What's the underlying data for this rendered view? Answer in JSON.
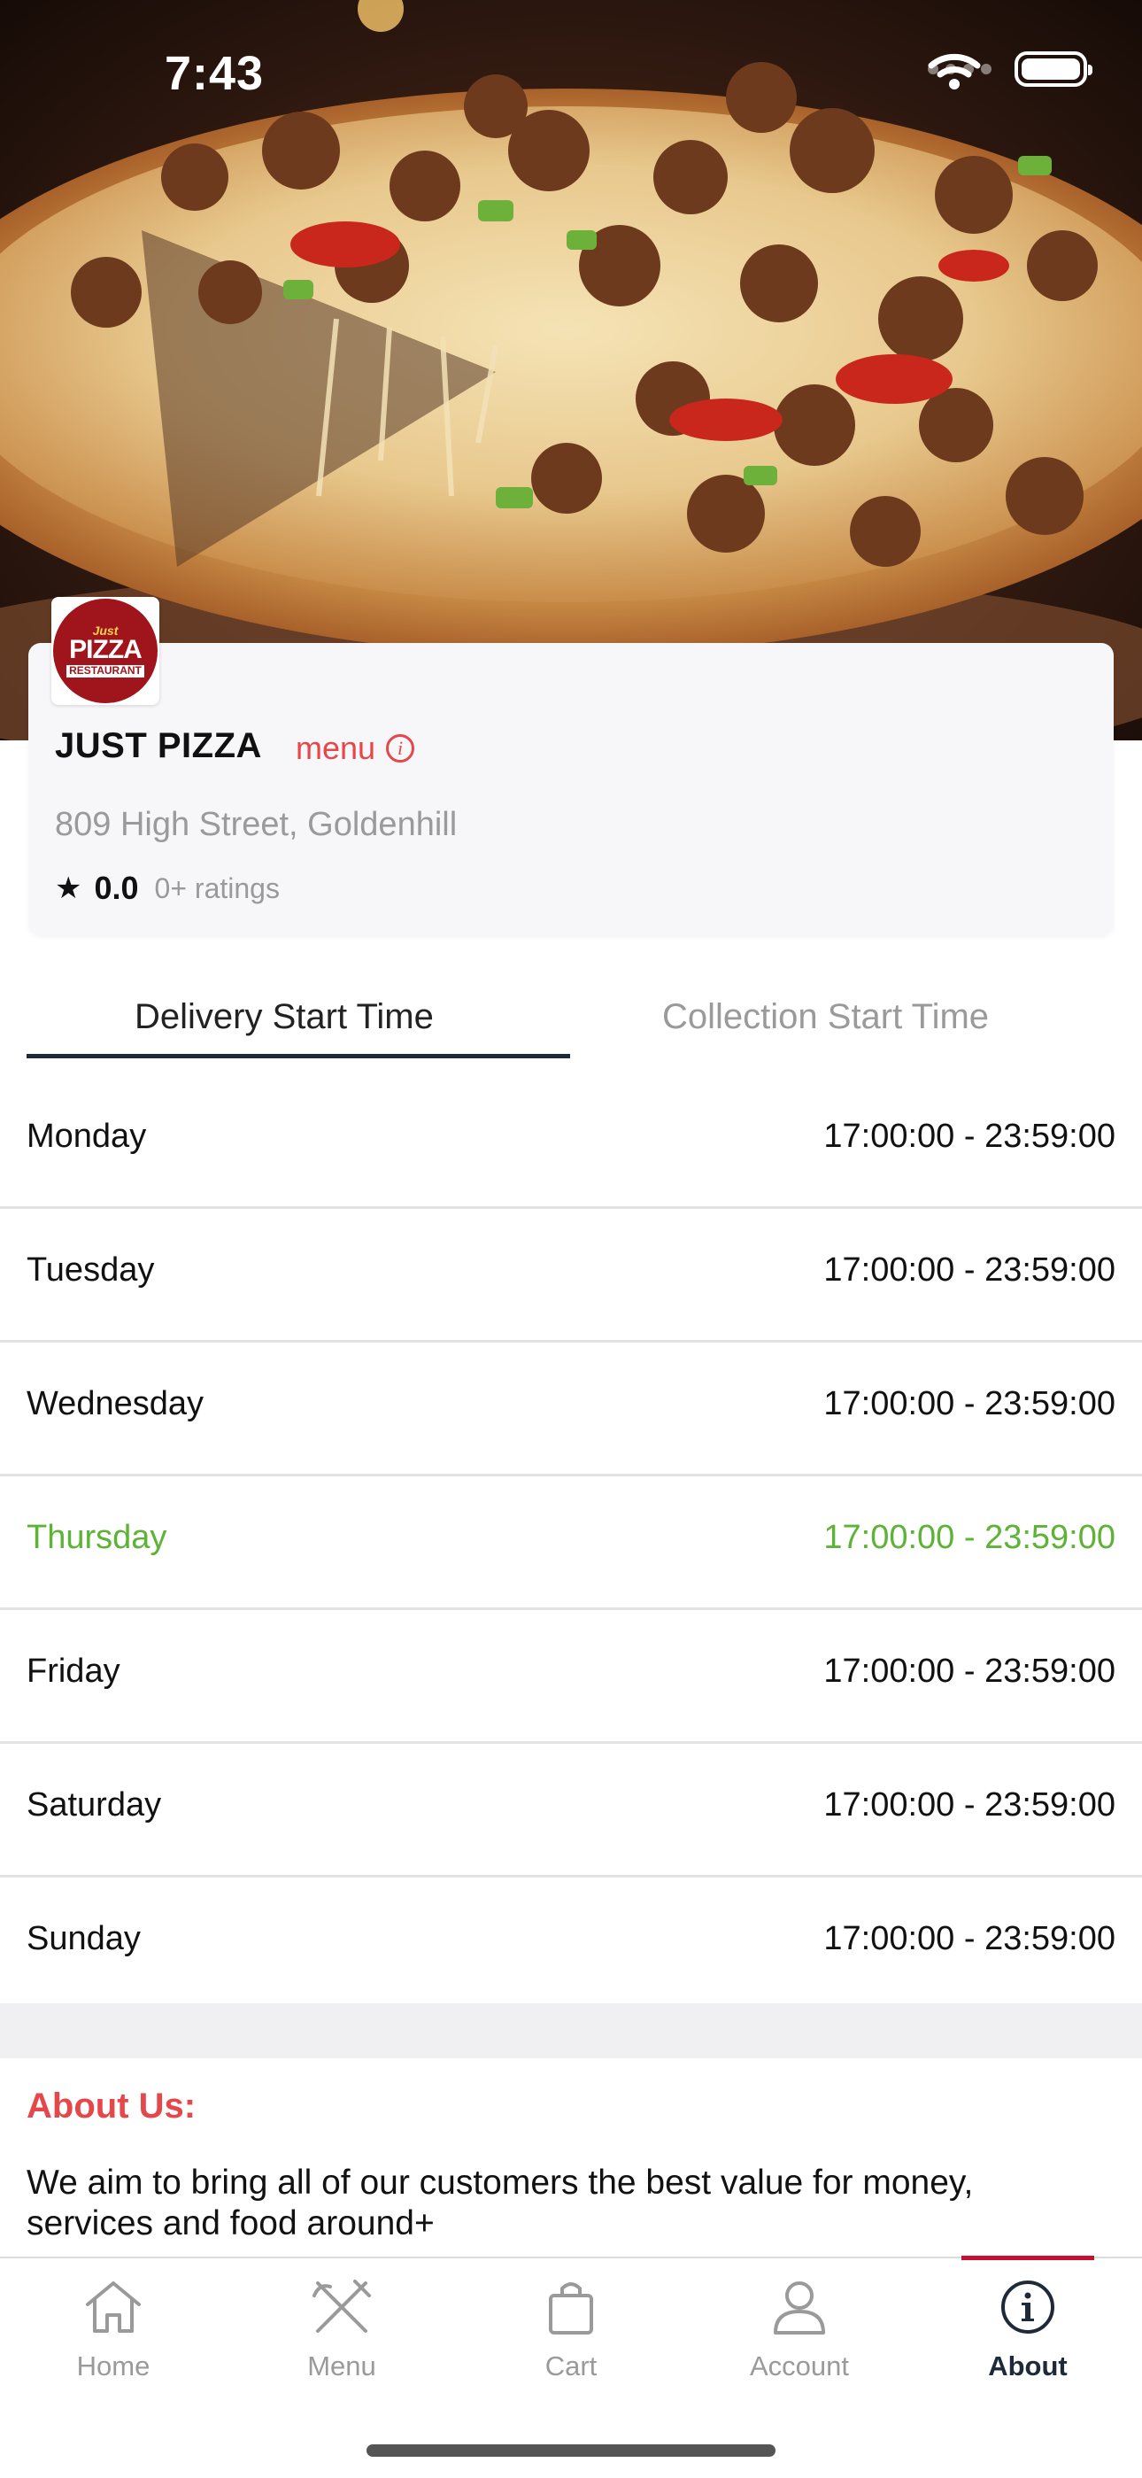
{
  "status_bar": {
    "time": "7:43"
  },
  "restaurant": {
    "logo_text_small": "Just",
    "logo_text_big": "PIZZA",
    "logo_text_sub": "RESTAURANT",
    "name": "JUST PIZZA",
    "menu_link": "menu",
    "address": "809 High Street, Goldenhill",
    "rating": "0.0",
    "rating_count": "0+ ratings"
  },
  "tabs": {
    "delivery": "Delivery Start Time",
    "collection": "Collection Start Time",
    "active": "delivery"
  },
  "hours": [
    {
      "day": "Monday",
      "time": "17:00:00 - 23:59:00"
    },
    {
      "day": "Tuesday",
      "time": "17:00:00 - 23:59:00"
    },
    {
      "day": "Wednesday",
      "time": "17:00:00 - 23:59:00"
    },
    {
      "day": "Thursday",
      "time": "17:00:00 - 23:59:00",
      "today": true
    },
    {
      "day": "Friday",
      "time": "17:00:00 - 23:59:00"
    },
    {
      "day": "Saturday",
      "time": "17:00:00 - 23:59:00"
    },
    {
      "day": "Sunday",
      "time": "17:00:00 - 23:59:00"
    }
  ],
  "about": {
    "title": "About Us:",
    "text": "We aim to bring all of our customers the best value for money, services and food around+"
  },
  "nav": [
    {
      "label": "Home",
      "icon": "home-icon"
    },
    {
      "label": "Menu",
      "icon": "fork-knife-icon"
    },
    {
      "label": "Cart",
      "icon": "shopping-bag-icon"
    },
    {
      "label": "Account",
      "icon": "user-icon"
    },
    {
      "label": "About",
      "icon": "info-icon",
      "active": true
    }
  ],
  "colors": {
    "accent_red": "#e5474b",
    "today_green": "#5cb335",
    "nav_active": "#1e2a3a",
    "tab_indicator": "#c8102e"
  }
}
